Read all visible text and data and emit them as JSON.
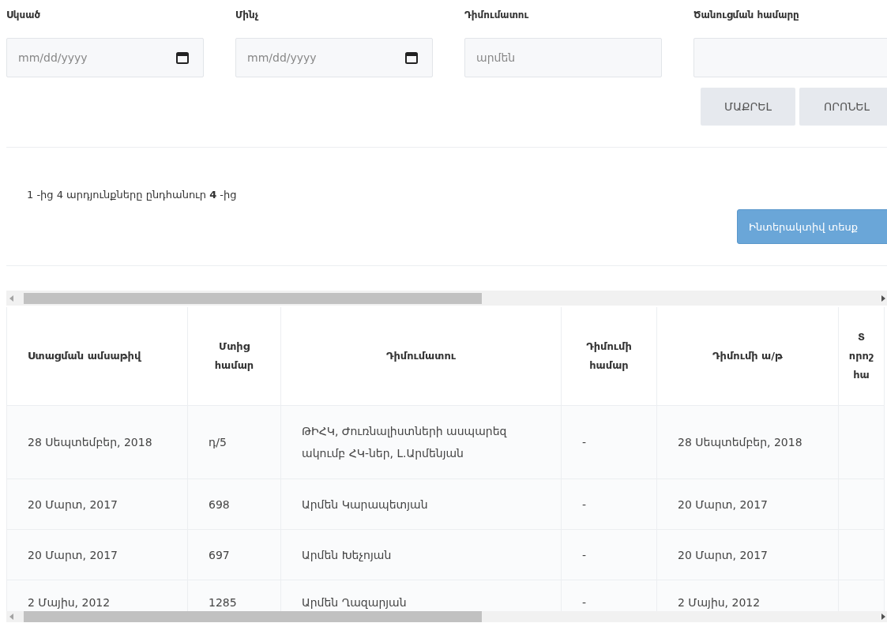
{
  "filters": [
    {
      "kind": "date",
      "label": "Սկսած",
      "placeholder": "mm/dd/yyyy"
    },
    {
      "kind": "date",
      "label": "Մինչ",
      "placeholder": "mm/dd/yyyy"
    },
    {
      "kind": "text",
      "label": "Դիմումատու",
      "placeholder": "արմեն"
    },
    {
      "kind": "text",
      "label": "Ծանուցման համարը"
    }
  ],
  "actions": [
    "ՄԱՔՐԵԼ",
    "ՈՐՈՆԵԼ"
  ],
  "results_summary": "1 -ից 4 արդյունքները ընդհանուր **4** -ից",
  "view_button": "Ինտերակտիվ տեսք",
  "table": {
    "columns": [
      "Ստացման ամսաթիվ",
      "Մտից\nհամար",
      "Դիմումատու",
      "Դիմումի\nհամար",
      "Դիմումի ա/թ",
      "Տ\nորոշ\nհա"
    ],
    "rows": [
      [
        "28 Սեպտեմբեր, 2018",
        "դ/5",
        "ԹԻՀԿ, Ժուռնալիստների ասպարեզ ակումբ ՀԿ-ներ, Լ.Արմենյան",
        "-",
        "28 Սեպտեմբեր, 2018"
      ],
      [
        "20 Մարտ, 2017",
        "698",
        "Արմեն Կարապետյան",
        "-",
        "20 Մարտ, 2017"
      ],
      [
        "20 Մարտ, 2017",
        "697",
        "Արմեն Խեչոյան",
        "-",
        "20 Մարտ, 2017"
      ],
      [
        "2 Մայիս, 2012",
        "1285",
        "Արմեն Ղազարյան",
        "-",
        "2 Մայիս, 2012"
      ]
    ]
  }
}
